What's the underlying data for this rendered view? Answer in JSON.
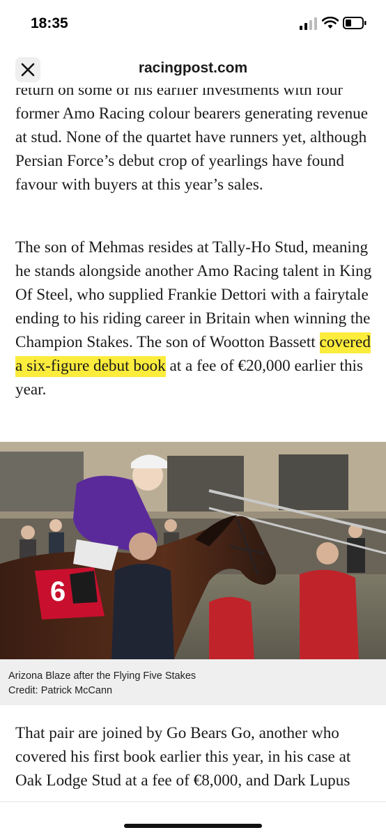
{
  "status_bar": {
    "time": "18:35",
    "icons": [
      "signal-icon",
      "wifi-icon",
      "battery-icon"
    ]
  },
  "url_bar": {
    "domain": "racingpost.com",
    "close_icon": "close-icon"
  },
  "article": {
    "para1": {
      "partial_top_line": "return on some of his earlier investments with",
      "text": "four former Amo Racing colour bearers generating revenue at stud. None of the quartet have runners yet, although Persian Force’s debut crop of yearlings have found favour with buyers at this year’s sales."
    },
    "para2": {
      "before": "The son of Mehmas resides at Tally-Ho Stud, meaning he stands alongside another Amo Racing talent in King Of Steel, who supplied Frankie Dettori with a fairytale ending to his riding career in Britain when winning the Champion Stakes. The son of Wootton Bassett ",
      "highlight": "covered a six-figure debut book",
      "after": " at a fee of €20,000 earlier this year."
    },
    "photo": {
      "saddle_cloth_number": "6"
    },
    "caption": {
      "line1": "Arizona Blaze after the Flying Five Stakes",
      "line2": "Credit: Patrick McCann"
    },
    "para3": {
      "text": "That pair are joined by Go Bears Go, another who covered his first book earlier this year, in his case at Oak Lodge Stud at a fee of €8,000, and Dark Lupus"
    }
  },
  "colors": {
    "highlight": "#fcec3c",
    "jockey_silks": "#5a2a9a",
    "saddle_cloth": "#c8102e"
  }
}
